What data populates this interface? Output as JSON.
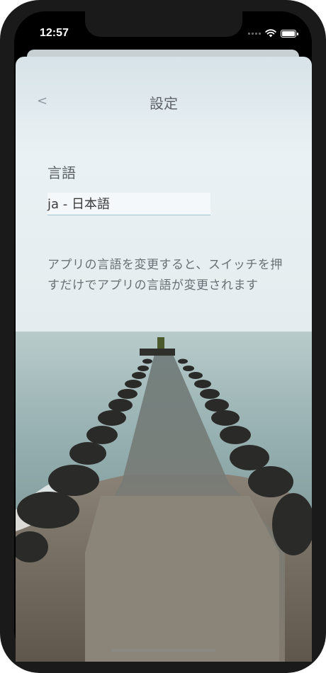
{
  "status_bar": {
    "time": "12:57",
    "icons": [
      "signal-icon",
      "wifi-icon",
      "battery-icon"
    ]
  },
  "nav": {
    "back_label": "<",
    "title": "設定"
  },
  "language": {
    "label": "言語",
    "value": "ja - 日本語"
  },
  "description": "アプリの言語を変更すると、スイッチを押すだけでアプリの言語が変更されます",
  "colors": {
    "sky_top": "#d9e5ea",
    "sky_mid": "#edf3f5",
    "sea": "#9fb8b9",
    "sand": "#6e6459",
    "frame": "#1a1a1a"
  }
}
